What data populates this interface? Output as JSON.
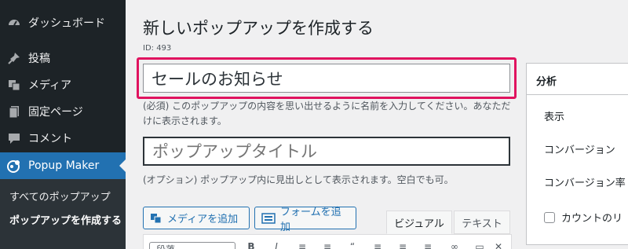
{
  "sidebar": {
    "dashboard": "ダッシュボード",
    "posts": "投稿",
    "media": "メディア",
    "pages": "固定ページ",
    "comments": "コメント",
    "popup_maker": "Popup Maker",
    "sub_all": "すべてのポップアップ",
    "sub_new": "ポップアップを作成する"
  },
  "page": {
    "title": "新しいポップアップを作成する",
    "id": "ID: 493"
  },
  "form": {
    "name_value": "セールのお知らせ",
    "name_help": "(必須) このポップアップの内容を思い出せるように名前を入力してください。あなただけに表示されます。",
    "title_placeholder": "ポップアップタイトル",
    "title_help": "(オプション) ポップアップ内に見出しとして表示されます。空白でも可。"
  },
  "editor": {
    "add_media": "メディアを追加",
    "add_form": "フォームを追加",
    "tab_visual": "ビジュアル",
    "tab_text": "テキスト",
    "format": "段落"
  },
  "analytics": {
    "title": "分析",
    "views": "表示",
    "conversions": "コンバージョン",
    "conversion_rate": "コンバージョン率",
    "reset_counts": "カウントのリ"
  },
  "colors": {
    "highlight": "#e0135f",
    "accent": "#2271b1",
    "sidebar_bg": "#1d2327"
  }
}
